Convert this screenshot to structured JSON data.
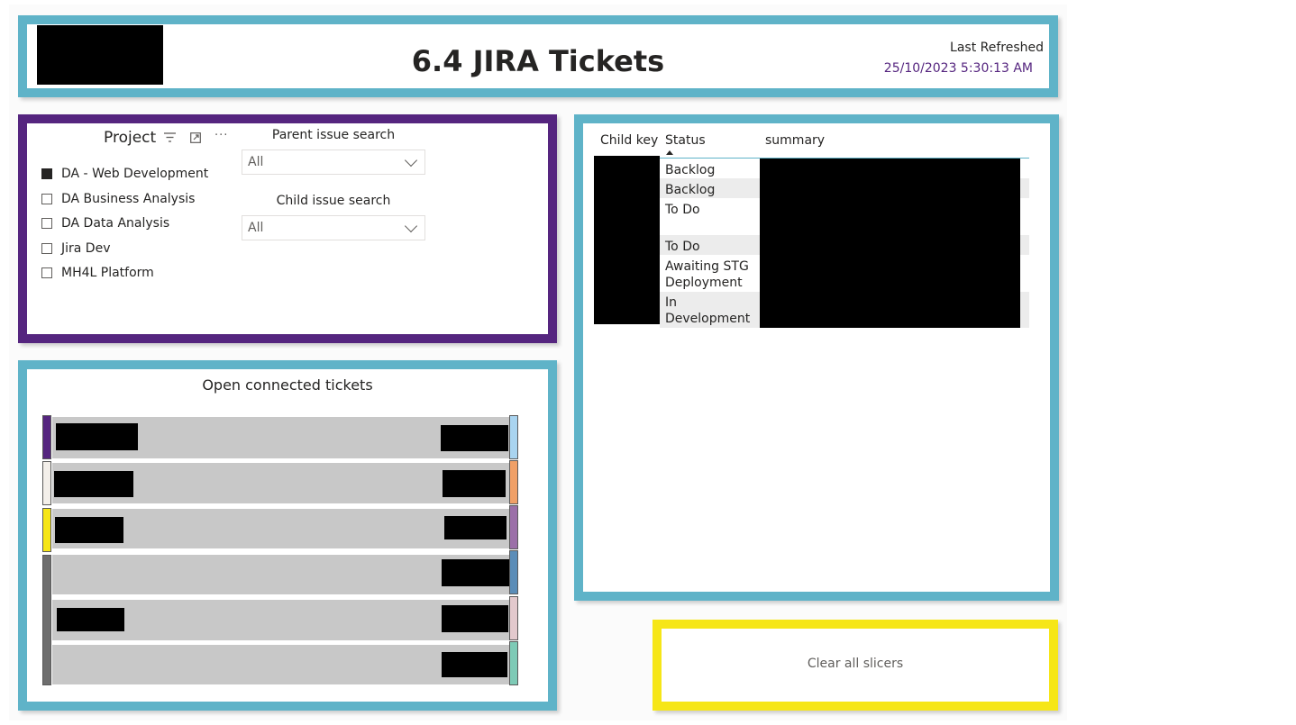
{
  "header": {
    "title": "6.4 JIRA Tickets",
    "last_refreshed_label": "Last Refreshed",
    "last_refreshed_value": "25/10/2023 5:30:13 AM"
  },
  "slicers": {
    "project_title": "Project",
    "projects": [
      {
        "label": "DA - Web Development",
        "checked": true
      },
      {
        "label": "DA Business Analysis",
        "checked": false
      },
      {
        "label": "DA Data Analysis",
        "checked": false
      },
      {
        "label": "Jira Dev",
        "checked": false
      },
      {
        "label": "MH4L Platform",
        "checked": false
      }
    ],
    "parent_search": {
      "title": "Parent issue search",
      "value": "All"
    },
    "child_search": {
      "title": "Child issue search",
      "value": "All"
    }
  },
  "sankey": {
    "title": "Open connected tickets",
    "left_node_colors": [
      "#55257f",
      "#f3efea",
      "#f6e617",
      "#6e6e6e"
    ],
    "right_node_colors": [
      "#a9d4f0",
      "#f0a067",
      "#9b6fa8",
      "#5b8db8",
      "#e3c9cd",
      "#7ecab6"
    ]
  },
  "table": {
    "columns": [
      "Child key",
      "Status",
      "summary"
    ],
    "rows": [
      {
        "status": "Backlog"
      },
      {
        "status": "Backlog"
      },
      {
        "status": "To Do"
      },
      {
        "status": "To Do"
      },
      {
        "status": "Awaiting STG Deployment"
      },
      {
        "status": "In Development"
      }
    ]
  },
  "clear_button": {
    "label": "Clear all slicers"
  }
}
